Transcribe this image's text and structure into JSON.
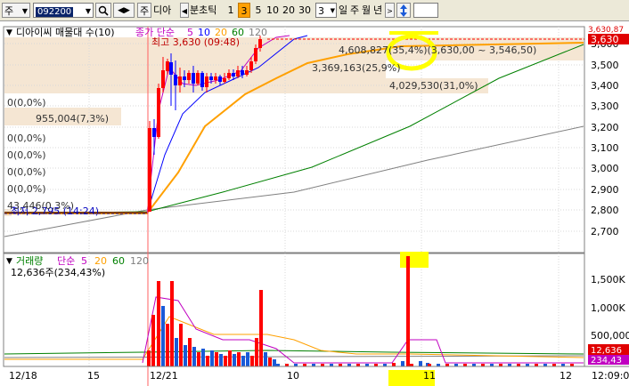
{
  "toolbar": {
    "type_label": "주",
    "code_value": "092200",
    "search_icon": "magnifier-icon",
    "lock_label": "주",
    "stock_name": "디아",
    "period_label": "분초틱",
    "period_options": [
      "1",
      "3",
      "5",
      "10",
      "20",
      "30"
    ],
    "selected_period": "3",
    "count_value": "3",
    "range_options": [
      "일",
      "주",
      "월",
      "년"
    ],
    "sort_icon": "up-down-arrow-icon"
  },
  "price_panel": {
    "legend_name": "디아이씨 매물대 수(10)",
    "ma_legend_label": "종가 단순",
    "ma_periods": [
      "5",
      "10",
      "20",
      "60",
      "120"
    ],
    "ma_colors": [
      "#c000c0",
      "#0000ff",
      "#ffa000",
      "#008000",
      "#808080"
    ],
    "high_label": "최고 3,630 (09:48)",
    "low_label": "최저 2,795 (14:24)",
    "profile_labels": [
      {
        "text": "4,608,827(35,4%)(3,630,00 ~ 3,546,50)"
      },
      {
        "text": "3,369,163(25,9%)"
      },
      {
        "text": "4,029,530(31,0%)"
      },
      {
        "text": "0(0,0%)"
      },
      {
        "text": "955,004(7,3%)"
      },
      {
        "text": "0(0,0%)"
      },
      {
        "text": "0(0,0%)"
      },
      {
        "text": "0(0,0%)"
      },
      {
        "text": "0(0,0%)"
      },
      {
        "text": "43,446(0,3%)"
      }
    ],
    "y_axis_ticks": [
      "3,600",
      "3,500",
      "3,400",
      "3,300",
      "3,200",
      "3,100",
      "3,000",
      "2,900",
      "2,800",
      "2,700"
    ],
    "current_price_tag": "3,630",
    "top_price_tag": "3,630,87"
  },
  "volume_panel": {
    "label": "거래량",
    "ma_label": "단순",
    "ma_periods": [
      "5",
      "20",
      "60",
      "120"
    ],
    "ma_colors": [
      "#c000c0",
      "#ffa000",
      "#008000",
      "#808080"
    ],
    "value_label": "12,636주(234,43%)",
    "y_axis_ticks": [
      "1,500K",
      "1,000K",
      "500,000"
    ],
    "current_volume_tag": "12,636",
    "ratio_tag": "234,43"
  },
  "x_axis": {
    "labels": [
      "12/18",
      "15",
      "12/21",
      "10",
      "11",
      "12"
    ],
    "time_label": "12:09:0"
  },
  "annotations": {
    "highlight_color": "#ffff00"
  },
  "colors": {
    "up": "#ff0000",
    "down": "#0000ff",
    "profile_fill": "#f5e6d3",
    "grid": "#c8c8c8"
  },
  "chart_data": {
    "type": "candlestick",
    "title": "디아이씨 매물대 수(10)",
    "y_range": [
      2650,
      3680
    ],
    "volume_range": [
      0,
      1800000
    ],
    "moving_averages": [
      5,
      10,
      20,
      60,
      120
    ],
    "high": 3630,
    "low": 2795,
    "volume_profile": [
      {
        "volume": 4608827,
        "percent": 35.4,
        "price_range": [
          3546.5,
          3630
        ]
      },
      {
        "volume": 3369163,
        "percent": 25.9
      },
      {
        "volume": 4029530,
        "percent": 31.0
      },
      {
        "volume": 955004,
        "percent": 7.3
      },
      {
        "volume": 43446,
        "percent": 0.3
      }
    ],
    "last_volume": 12636,
    "volume_ratio_percent": 234.43
  }
}
